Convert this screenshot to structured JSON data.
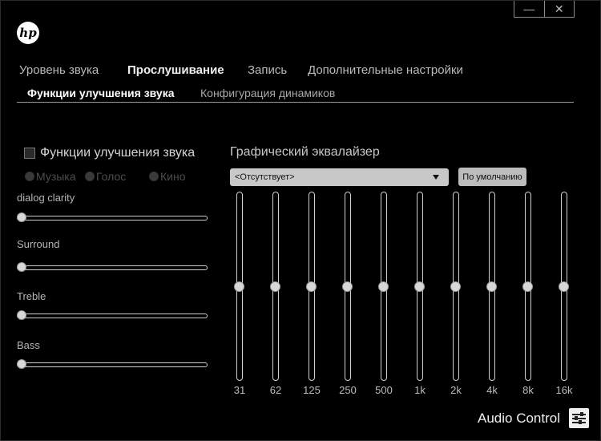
{
  "window": {
    "min_glyph": "—",
    "close_glyph": "✕"
  },
  "logo": {
    "text": "hp"
  },
  "tabs": [
    {
      "label": "Уровень звука",
      "active": false
    },
    {
      "label": "Прослушивание",
      "active": true
    },
    {
      "label": "Запись",
      "active": false
    },
    {
      "label": "Дополнительные настройки",
      "active": false
    }
  ],
  "subtabs": [
    {
      "label": "Функции улучшения звука",
      "active": true
    },
    {
      "label": "Конфигурация динамиков",
      "active": false
    }
  ],
  "enhancements": {
    "checkbox_label": "Функции улучшения звука",
    "checked": false,
    "modes": [
      "Музыка",
      "Голос",
      "Кино"
    ]
  },
  "sliders": [
    {
      "label": "dialog clarity",
      "value": 0
    },
    {
      "label": "Surround",
      "value": 0
    },
    {
      "label": "Treble",
      "value": 0
    },
    {
      "label": "Bass",
      "value": 0
    }
  ],
  "equalizer": {
    "title": "Графический эквалайзер",
    "preset": "<Отсутствует>",
    "default_button": "По умолчанию",
    "bands": [
      {
        "freq": "31",
        "level": 0.5
      },
      {
        "freq": "62",
        "level": 0.5
      },
      {
        "freq": "125",
        "level": 0.5
      },
      {
        "freq": "250",
        "level": 0.5
      },
      {
        "freq": "500",
        "level": 0.5
      },
      {
        "freq": "1k",
        "level": 0.5
      },
      {
        "freq": "2k",
        "level": 0.5
      },
      {
        "freq": "4k",
        "level": 0.5
      },
      {
        "freq": "8k",
        "level": 0.5
      },
      {
        "freq": "16k",
        "level": 0.5
      }
    ]
  },
  "brand": {
    "label": "Audio Control",
    "icon": "sliders-icon"
  }
}
